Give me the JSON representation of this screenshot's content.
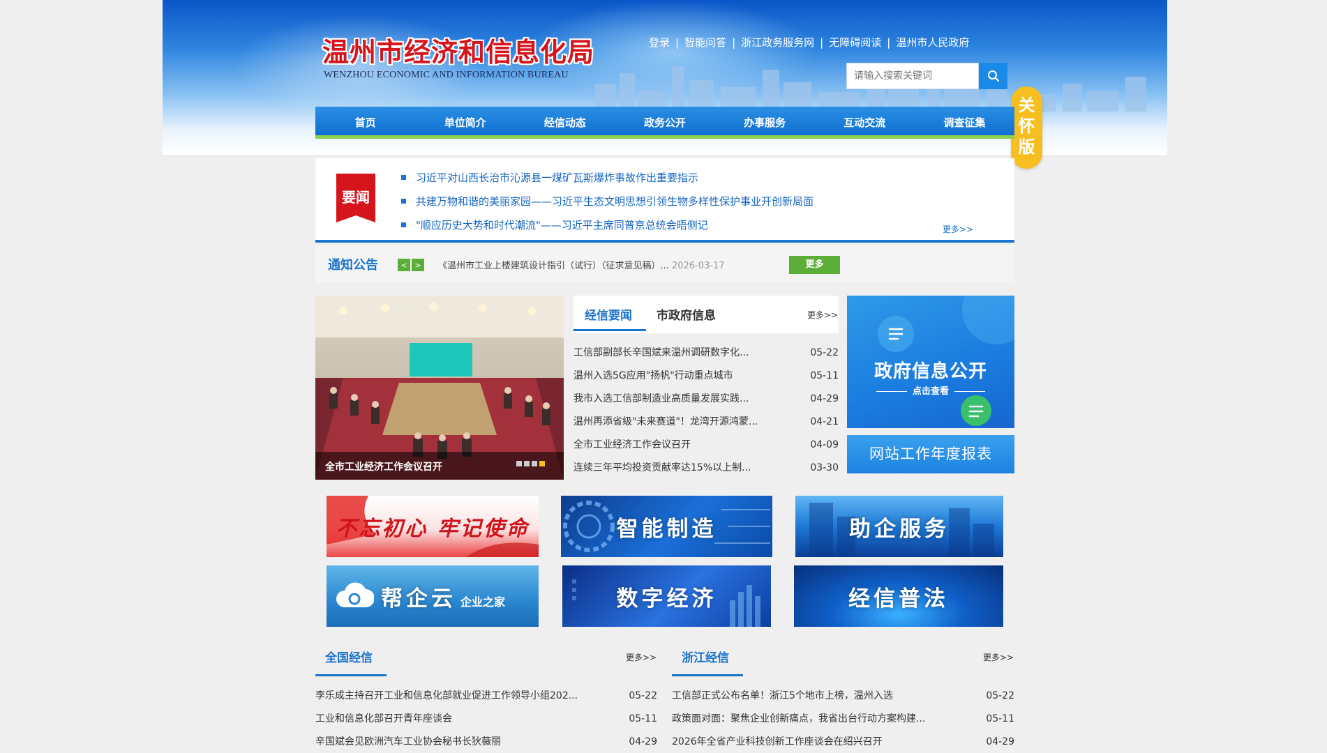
{
  "header": {
    "title": "温州市经济和信息化局",
    "subtitle": "WENZHOU ECONOMIC AND INFORMATION BUREAU",
    "top_links": [
      "登录",
      "智能问答",
      "浙江政务服务网",
      "无障碍阅读",
      "温州市人民政府"
    ],
    "search": {
      "placeholder": "请输入搜索关键词"
    },
    "care_badge": [
      "关",
      "怀",
      "版"
    ]
  },
  "nav": {
    "items": [
      "首页",
      "单位简介",
      "经信动态",
      "政务公开",
      "办事服务",
      "互动交流",
      "调查征集"
    ]
  },
  "headline": {
    "badge": "要闻",
    "items": [
      "习近平对山西长治市沁源县一煤矿瓦斯爆炸事故作出重要指示",
      "共建万物和谐的美丽家园——习近平生态文明思想引领生物多样性保护事业开创新局面",
      "\"顺应历史大势和时代潮流\"——习近平主席同普京总统会晤侧记"
    ],
    "more": "更多>>"
  },
  "notice": {
    "label": "通知公告",
    "prev": "<",
    "next": ">",
    "text": "《温州市工业上楼建筑设计指引（试行）（征求意见稿）... ",
    "date": "2026-03-17",
    "more": "更多"
  },
  "photo": {
    "caption": "全市工业经济工作会议召开",
    "dots": 4,
    "active_dot": 3
  },
  "news": {
    "tabs": [
      "经信要闻",
      "市政府信息"
    ],
    "active_tab": 0,
    "more": "更多>>",
    "items": [
      {
        "title": "工信部副部长辛国斌来温州调研数字化...",
        "date": "05-22"
      },
      {
        "title": "温州入选5G应用\"扬帆\"行动重点城市",
        "date": "05-11"
      },
      {
        "title": "我市入选工信部制造业高质量发展实践...",
        "date": "04-29"
      },
      {
        "title": "温州再添省级\"未来赛道\"！龙湾开源鸿蒙...",
        "date": "04-21"
      },
      {
        "title": "全市工业经济工作会议召开",
        "date": "04-09"
      },
      {
        "title": "连续三年平均投资贡献率达15%以上制...",
        "date": "03-30"
      }
    ]
  },
  "side_banners": {
    "info_title": "政府信息公开",
    "info_sub": "点击查看",
    "report": "网站工作年度报表"
  },
  "tiles": [
    "不忘初心 牢记使命",
    "智能制造",
    "助企服务",
    "帮企云",
    "数字经济",
    "经信普法"
  ],
  "tile_extra": {
    "cloud_sub": "企业之家"
  },
  "bottom": {
    "left": {
      "tab": "全国经信",
      "more": "更多>>",
      "items": [
        {
          "title": "李乐成主持召开工业和信息化部就业促进工作领导小组202...",
          "date": "05-22"
        },
        {
          "title": "工业和信息化部召开青年座谈会",
          "date": "05-11"
        },
        {
          "title": "辛国斌会见欧洲汽车工业协会秘书长狄薇丽",
          "date": "04-29"
        }
      ]
    },
    "right": {
      "tab": "浙江经信",
      "more": "更多>>",
      "items": [
        {
          "title": "工信部正式公布名单！浙江5个地市上榜，温州入选",
          "date": "05-22"
        },
        {
          "title": "政策面对面：聚焦企业创新痛点，我省出台行动方案构建...",
          "date": "05-11"
        },
        {
          "title": "2026年全省产业科技创新工作座谈会在绍兴召开",
          "date": "04-29"
        }
      ]
    }
  },
  "colors": {
    "brand_blue": "#1a73cc",
    "title_red": "#d6141c",
    "accent_green": "#5cae38",
    "care_yellow": "#f6bf1f"
  }
}
